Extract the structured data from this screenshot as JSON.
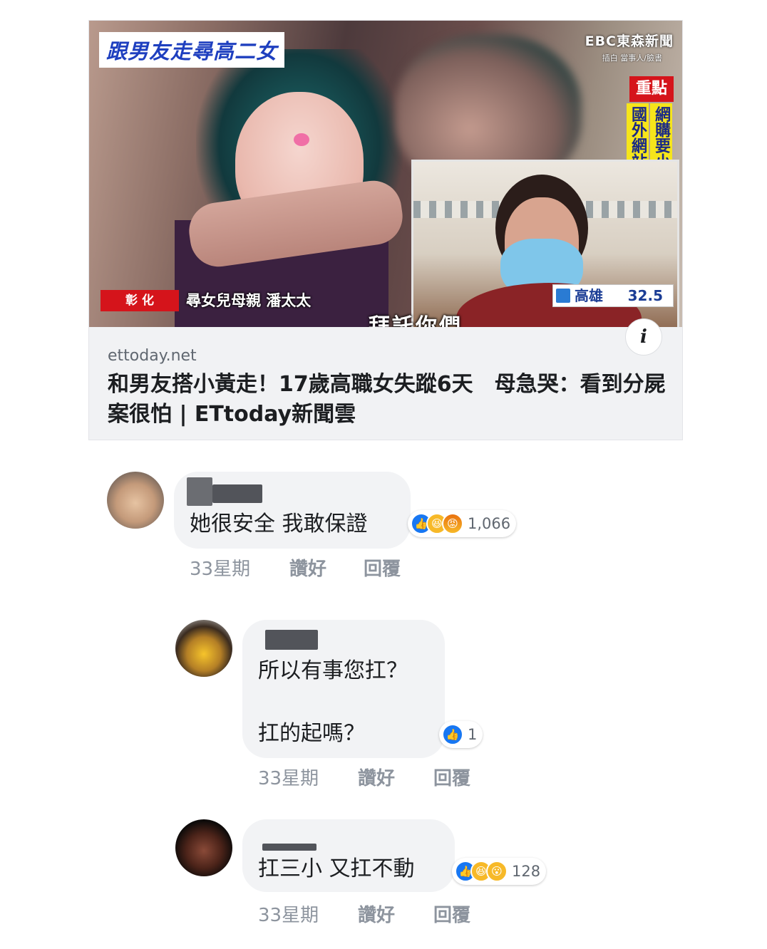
{
  "post": {
    "thumbnail": {
      "headline_banner": "跟男友走尋高二女",
      "channel_logo": "EBC東森新聞",
      "channel_sub": "插白 當事人/臉書",
      "focus_tag": "重點",
      "focus_col1": "網購要小心陷阱",
      "focus_col2": "國外網站無法罰",
      "location_tag": "彰 化",
      "caption": "尋女兒母親 潘太太",
      "weather_city": "高雄",
      "weather_temp": "32.5",
      "subtitle": "拜託你們"
    },
    "domain": "ettoday.net",
    "title": "和男友搭小黃走！17歲高職女失蹤6天　母急哭：看到分屍案很怕 | ETtoday新聞雲"
  },
  "comments": [
    {
      "text": "她很安全 我敢保證",
      "reactions": [
        "like",
        "haha",
        "angry"
      ],
      "reaction_count": "1,066",
      "time": "33星期",
      "like_label": "讚好",
      "reply_label": "回覆"
    },
    {
      "text_line1": "所以有事您扛？",
      "text_line2": "扛的起嗎？",
      "reactions": [
        "like"
      ],
      "reaction_count": "1",
      "time": "33星期",
      "like_label": "讚好",
      "reply_label": "回覆"
    },
    {
      "text": "扛三小 又扛不動",
      "reactions": [
        "like",
        "haha",
        "wow"
      ],
      "reaction_count": "128",
      "time": "33星期",
      "like_label": "讚好",
      "reply_label": "回覆"
    }
  ],
  "colors": {
    "like": "#1877f2",
    "haha": "#f7b928",
    "bubble": "#f2f3f5",
    "meta": "#8d949e"
  }
}
